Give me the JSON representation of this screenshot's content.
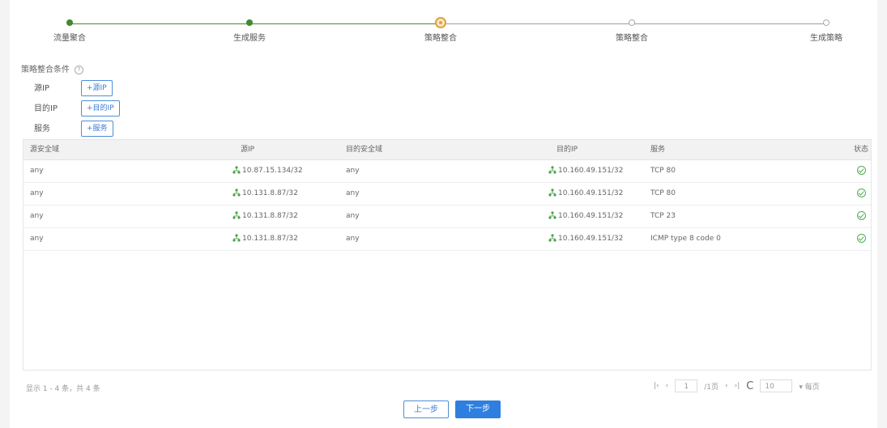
{
  "steps": [
    {
      "label": "流量聚合",
      "state": "done"
    },
    {
      "label": "生成服务",
      "state": "done"
    },
    {
      "label": "策略整合",
      "state": "current"
    },
    {
      "label": "策略整合",
      "state": "todo"
    },
    {
      "label": "生成策略",
      "state": "todo"
    }
  ],
  "conditions": {
    "title": "策略整合条件",
    "rows": [
      {
        "label": "源IP",
        "button": "+源IP"
      },
      {
        "label": "目的IP",
        "button": "+目的IP"
      },
      {
        "label": "服务",
        "button": "+服务"
      }
    ]
  },
  "table": {
    "columns": [
      "源安全域",
      "源IP",
      "目的安全域",
      "目的IP",
      "服务",
      "状态"
    ],
    "rows": [
      {
        "src_zone": "any",
        "src_ip": "10.87.15.134/32",
        "dst_zone": "any",
        "dst_ip": "10.160.49.151/32",
        "service": "TCP 80"
      },
      {
        "src_zone": "any",
        "src_ip": "10.131.8.87/32",
        "dst_zone": "any",
        "dst_ip": "10.160.49.151/32",
        "service": "TCP 80"
      },
      {
        "src_zone": "any",
        "src_ip": "10.131.8.87/32",
        "dst_zone": "any",
        "dst_ip": "10.160.49.151/32",
        "service": "TCP 23"
      },
      {
        "src_zone": "any",
        "src_ip": "10.131.8.87/32",
        "dst_zone": "any",
        "dst_ip": "10.160.49.151/32",
        "service": "ICMP type 8 code 0"
      }
    ]
  },
  "footer": {
    "info": "显示 1 - 4 条，共 4 条",
    "pager": {
      "first": "|‹",
      "prev": "‹",
      "page": "1",
      "total": "/1页",
      "next": "›",
      "last": "›|",
      "refresh": "C",
      "page_size": "10",
      "per_page": "▾ 每页"
    }
  },
  "buttons": {
    "prev": "上一步",
    "next": "下一步"
  },
  "colors": {
    "accent": "#2f7fe0",
    "done": "#3f8a2f",
    "current": "#e0a13c",
    "status": "#4caf50"
  }
}
